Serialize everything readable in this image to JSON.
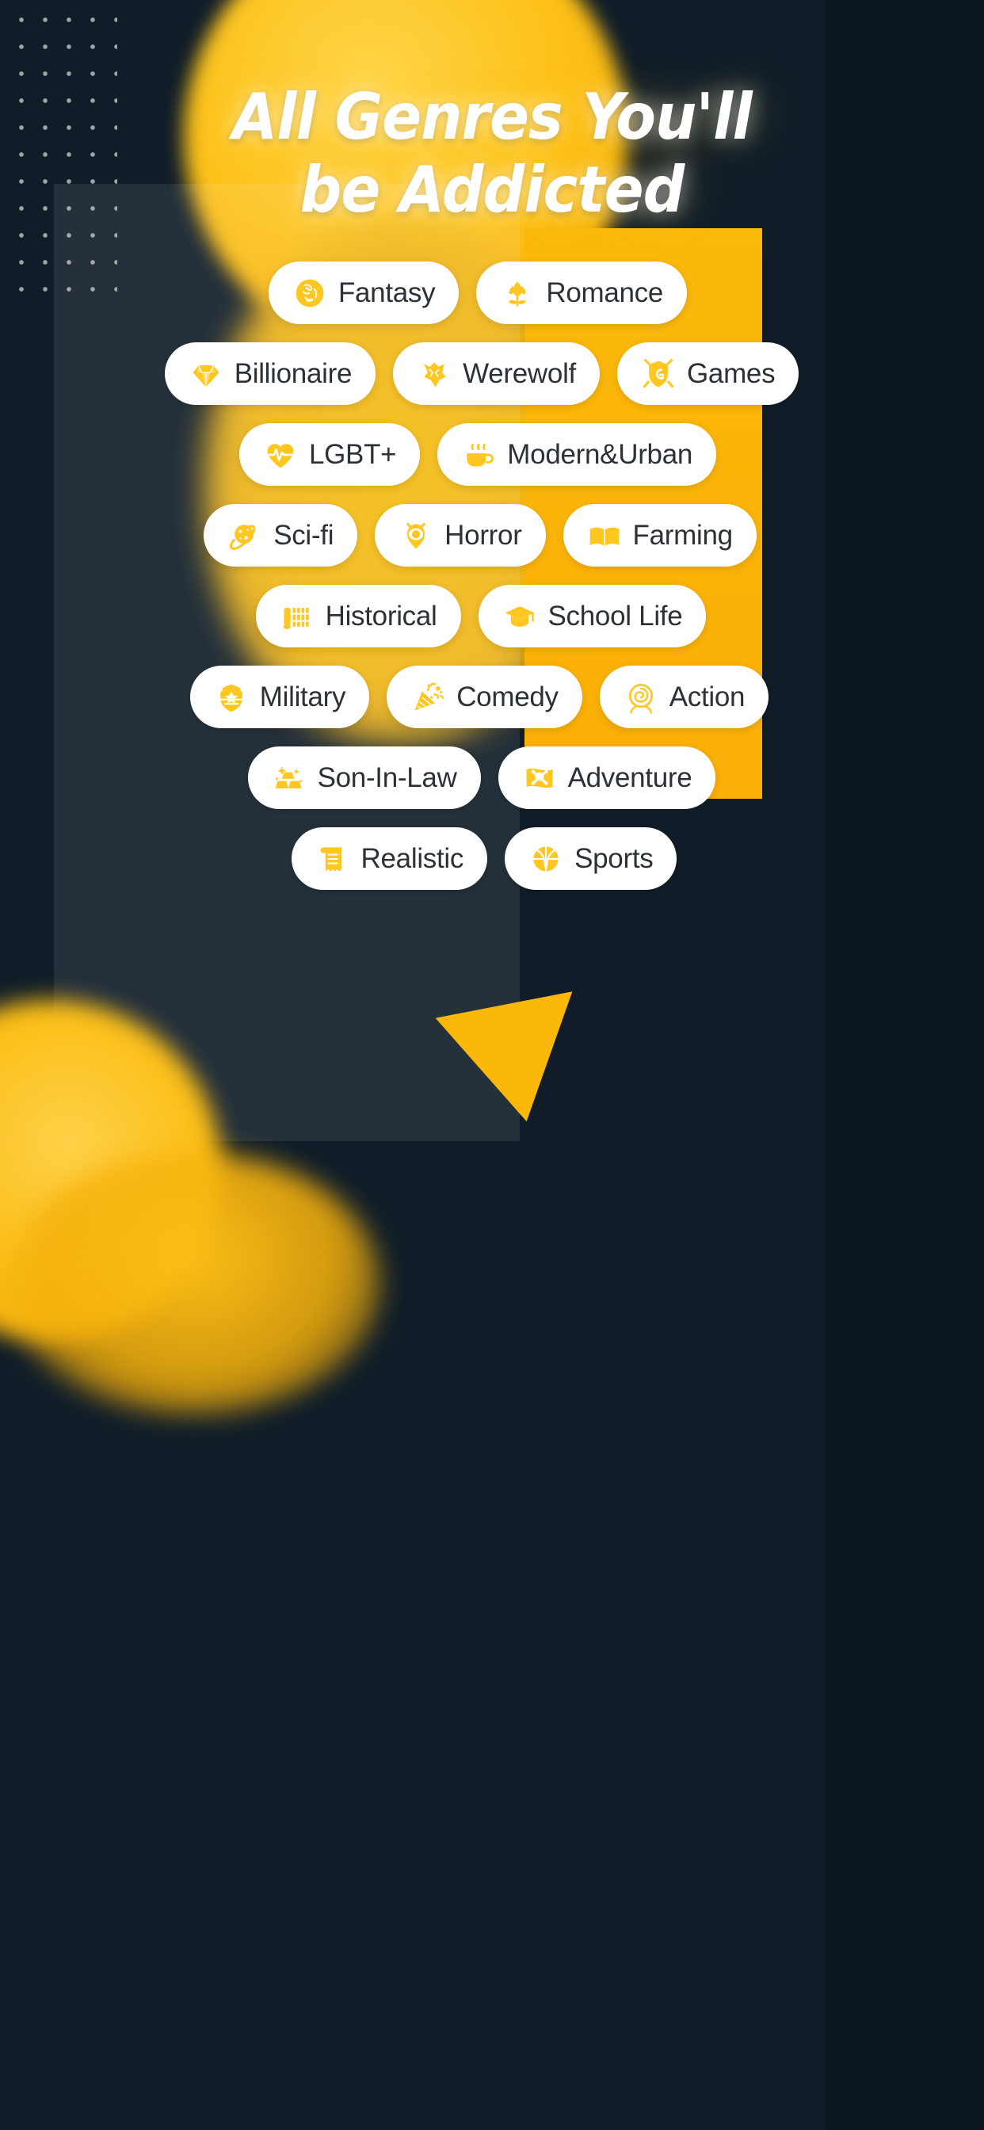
{
  "page": {
    "title_line1": "All Genres You'll",
    "title_line2": "be Addicted",
    "colors": {
      "background_dark": "#101d28",
      "panel_overlay": "rgba(255,255,255,0.085)",
      "accent_gold": "#FBB90A",
      "icon_yellow": "#FFC720",
      "pill_background": "#FFFFFF",
      "pill_text": "#2C3138",
      "dot_grid": "#C9CBC4"
    }
  },
  "genres": {
    "rows": [
      [
        {
          "label": "Fantasy",
          "icon": "dragon-icon"
        },
        {
          "label": "Romance",
          "icon": "tulip-icon"
        }
      ],
      [
        {
          "label": "Billionaire",
          "icon": "diamond-icon"
        },
        {
          "label": "Werewolf",
          "icon": "wolf-head-icon"
        },
        {
          "label": "Games",
          "icon": "shield-g-icon"
        }
      ],
      [
        {
          "label": "LGBT+",
          "icon": "heartbeat-icon"
        },
        {
          "label": "Modern&Urban",
          "icon": "coffee-cup-icon"
        }
      ],
      [
        {
          "label": "Sci-fi",
          "icon": "planet-icon"
        },
        {
          "label": "Horror",
          "icon": "evil-eye-icon"
        },
        {
          "label": "Farming",
          "icon": "open-book-icon"
        }
      ],
      [
        {
          "label": "Historical",
          "icon": "bamboo-scroll-icon"
        },
        {
          "label": "School Life",
          "icon": "graduation-cap-icon"
        }
      ],
      [
        {
          "label": "Military",
          "icon": "star-badge-icon"
        },
        {
          "label": "Comedy",
          "icon": "party-popper-icon"
        },
        {
          "label": "Action",
          "icon": "rose-icon"
        }
      ],
      [
        {
          "label": "Son-In-Law",
          "icon": "gold-bars-icon"
        },
        {
          "label": "Adventure",
          "icon": "pirate-flag-icon"
        }
      ],
      [
        {
          "label": "Realistic",
          "icon": "receipt-scroll-icon"
        },
        {
          "label": "Sports",
          "icon": "basketball-icon"
        }
      ]
    ]
  },
  "decorations": {
    "dot_grid": "dot-grid-pattern",
    "gold_rectangle": "gold-rectangle-shape",
    "gold_triangle": "gold-triangle-shape",
    "blob_top": "yellow-blur-circle-top",
    "blob_bottom_left": "yellow-blur-circle-bottom-left"
  }
}
